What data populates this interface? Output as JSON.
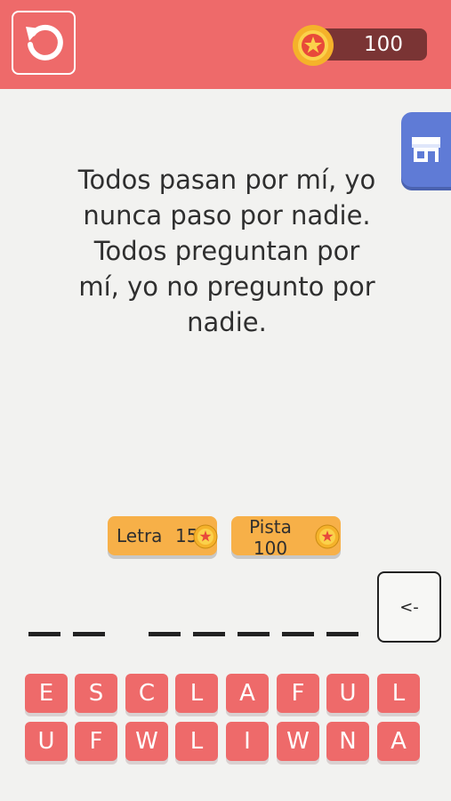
{
  "header": {
    "restart_icon": "restart-icon",
    "coins": "100",
    "coin_icon": "star-coin-icon"
  },
  "shop": {
    "icon": "store-icon"
  },
  "riddle": {
    "lines": [
      "Todos pasan por mí, yo",
      "nunca paso por nadie.",
      "Todos preguntan por",
      "mí, yo no pregunto por",
      "nadie."
    ]
  },
  "hints": {
    "letra_label": "Letra",
    "letra_cost": "15",
    "pista_label": "Pista 100"
  },
  "answer": {
    "slots": [
      "",
      "",
      "",
      "",
      "",
      "",
      "",
      ""
    ],
    "backspace_label": "<-"
  },
  "keyboard": {
    "row1": [
      "E",
      "S",
      "C",
      "L",
      "A",
      "F",
      "U",
      "L"
    ],
    "row2": [
      "U",
      "F",
      "W",
      "L",
      "I",
      "W",
      "N",
      "A"
    ]
  },
  "colors": {
    "accent": "#ee6a6a",
    "coin_pill": "#7a3434",
    "hint": "#f7b048",
    "shop": "#5f7bd6"
  }
}
